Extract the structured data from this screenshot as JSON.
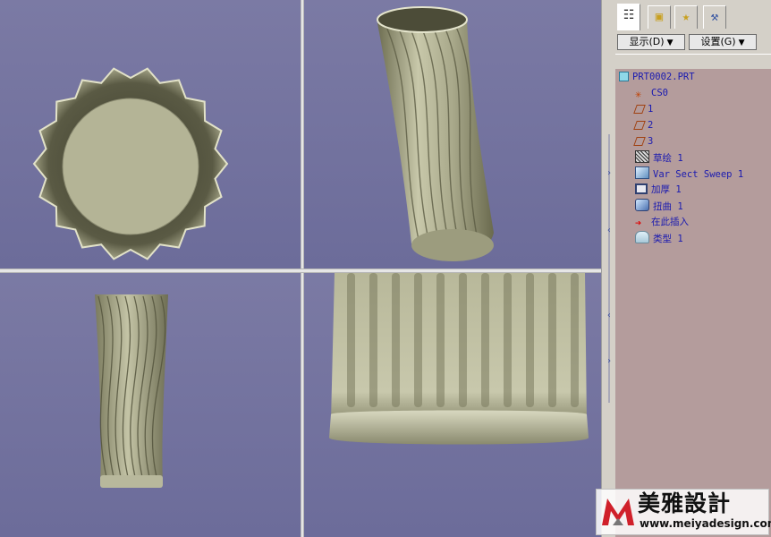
{
  "title": "PRT0002.PRT",
  "viewports": [
    {
      "name": "top-view",
      "view": "top"
    },
    {
      "name": "iso-view",
      "view": "isometric"
    },
    {
      "name": "front-view",
      "view": "front"
    },
    {
      "name": "detail-view",
      "view": "detail"
    }
  ],
  "panel": {
    "tabs": [
      {
        "name": "model-tree",
        "icon": "tree-icon",
        "active": true
      },
      {
        "name": "folder-browser",
        "icon": "folders-icon",
        "active": false
      },
      {
        "name": "favorites",
        "icon": "star-icon",
        "active": false
      },
      {
        "name": "connections",
        "icon": "connections-icon",
        "active": false
      }
    ],
    "display_menu": "显示(D)",
    "settings_menu": "设置(G)",
    "tree": {
      "root": "PRT0002.PRT",
      "items": [
        {
          "label": "CS0",
          "icon": "coordinate-system-icon"
        },
        {
          "label": "1",
          "icon": "datum-plane-icon"
        },
        {
          "label": "2",
          "icon": "datum-plane-icon"
        },
        {
          "label": "3",
          "icon": "datum-plane-icon"
        },
        {
          "label": "草绘 1",
          "icon": "sketch-icon"
        },
        {
          "label": "Var Sect Sweep 1",
          "icon": "sweep-icon"
        },
        {
          "label": "加厚 1",
          "icon": "thicken-icon"
        },
        {
          "label": "扭曲 1",
          "icon": "warp-icon"
        },
        {
          "label": "在此插入",
          "icon": "insert-here-arrow-icon"
        },
        {
          "label": "类型 1",
          "icon": "style-icon"
        }
      ]
    }
  },
  "watermark": {
    "brand_cn": "美雅設計",
    "url": "www.meiyadesign.com"
  },
  "colors": {
    "viewport_bg": "#7574a0",
    "model_fill": "#b4b496",
    "model_shadow": "#6e6e52",
    "panel_bg": "#b49c9c",
    "tree_text": "#1a1ab0"
  }
}
